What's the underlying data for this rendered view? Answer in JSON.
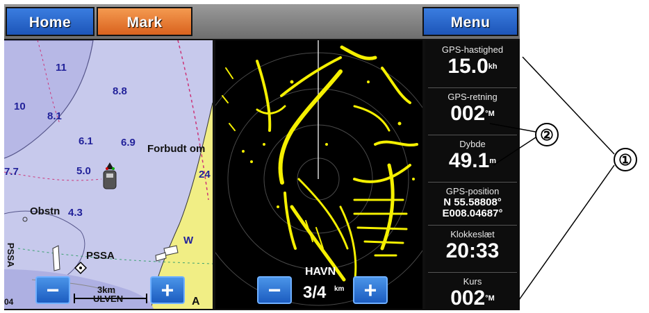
{
  "toolbar": {
    "home_label": "Home",
    "mark_label": "Mark",
    "menu_label": "Menu"
  },
  "chart": {
    "depths": [
      "11",
      "8.8",
      "10",
      "8.1",
      "6.1",
      "6.9",
      "7.7",
      "5.0",
      "4.3",
      "24"
    ],
    "labels": {
      "forbudt": "Forbudt om",
      "obstn": "Obstn",
      "pssa": "PSSA",
      "pssa_vertical": "PSSA",
      "w_mark": "W",
      "edge_number": "04"
    },
    "scale": {
      "value": "3km",
      "place": "ULVEN"
    },
    "north_symbol": "A"
  },
  "radar": {
    "place": "HAVN",
    "range_value": "3/4",
    "range_unit": "km"
  },
  "data_fields": {
    "speed": {
      "label": "GPS-hastighed",
      "value": "15.0",
      "unit": "kh"
    },
    "heading": {
      "label": "GPS-retning",
      "value": "002",
      "unit": "°M"
    },
    "depth": {
      "label": "Dybde",
      "value": "49.1",
      "unit": "m"
    },
    "position": {
      "label": "GPS-position",
      "lat": "N  55.58808°",
      "lon": "E008.04687°"
    },
    "clock": {
      "label": "Klokkeslæt",
      "value": "20:33"
    },
    "course": {
      "label": "Kurs",
      "value": "002",
      "unit": "°M"
    }
  },
  "callouts": {
    "one": "①",
    "two": "②"
  },
  "colors": {
    "button_blue": "#2a68d0",
    "button_orange": "#e8782f",
    "chart_water": "#c7c9ec",
    "land": "#f1ee85",
    "radar_echo": "#f5f000"
  }
}
